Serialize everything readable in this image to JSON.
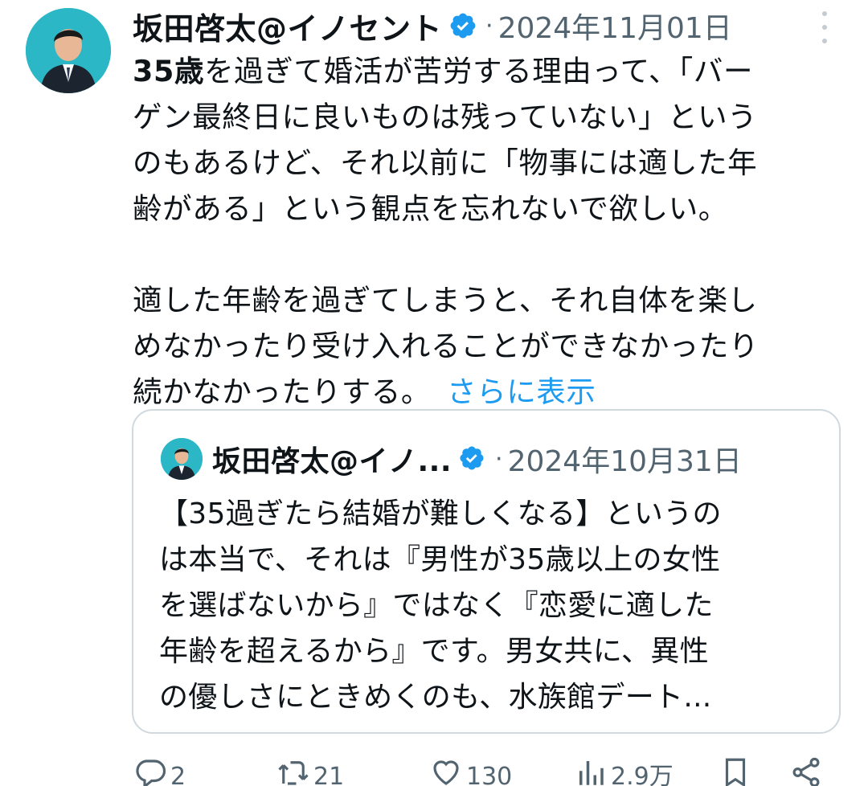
{
  "tweet": {
    "author": "坂田啓太@イノセント",
    "separator": "·",
    "date": "2024年11月01日",
    "lead_bold": "35歳",
    "p1_rest": "を過ぎて婚活が苦労する理由って、「バー",
    "p1_l2": "ゲン最終日に良いものは残っていない」という",
    "p1_l3": "のもあるけど、それ以前に「物事には適した年",
    "p1_l4": "齢がある」という観点を忘れないで欲しい。",
    "p2_l1": "適した年齢を過ぎてしまうと、それ自体を楽し",
    "p2_l2": "めなかったり受け入れることができなかったり",
    "p2_l3": "続かなかったりする。",
    "show_more": "さらに表示"
  },
  "quote": {
    "author": "坂田啓太@イノ...",
    "separator": "·",
    "date": "2024年10月31日",
    "lines": [
      "【35過ぎたら結婚が難しくなる】というの",
      "は本当で、それは『男性が35歳以上の女性",
      "を選ばないから』ではなく『恋愛に適した",
      "年齢を超えるから』です。男女共に、異性",
      "の優しさにときめくのも、水族館デート..."
    ]
  },
  "actions": {
    "reply": {
      "icon": "reply-icon",
      "count": "2"
    },
    "retweet": {
      "icon": "retweet-icon",
      "count": "21"
    },
    "like": {
      "icon": "heart-icon",
      "count": "130"
    },
    "views": {
      "icon": "views-icon",
      "count": "2.9万"
    },
    "bookmark": {
      "icon": "bookmark-icon"
    },
    "share": {
      "icon": "share-icon"
    }
  },
  "colors": {
    "link": "#1d9bf0",
    "muted": "#536471",
    "verified": "#1d9bf0",
    "avatar_bg": "#2cb7c7",
    "border": "#cfd9de"
  }
}
